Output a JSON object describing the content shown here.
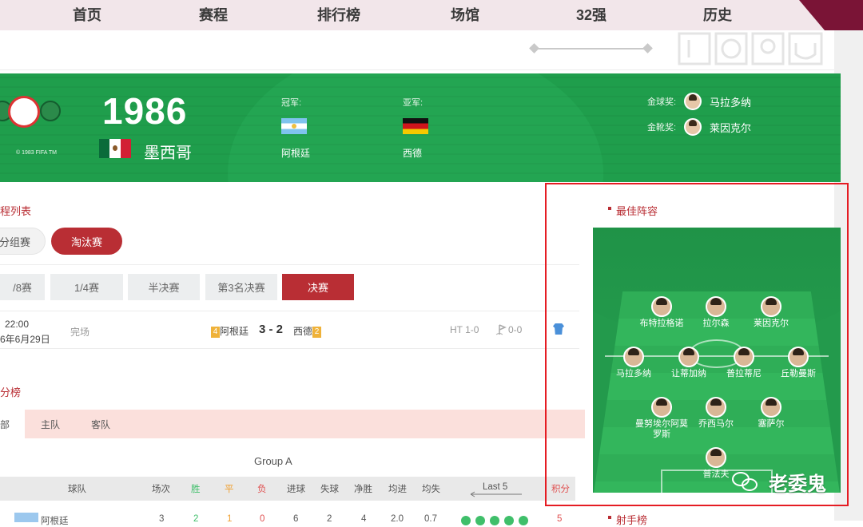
{
  "nav": {
    "items": [
      "首页",
      "赛程",
      "排行榜",
      "场馆",
      "32强",
      "历史"
    ]
  },
  "banner": {
    "fifa_tm": "© 1983 FIFA TM",
    "year": "1986",
    "host": "墨西哥",
    "champion_label": "冠军:",
    "champion": "阿根廷",
    "runner_up_label": "亚军:",
    "runner_up": "西德",
    "golden_ball_label": "金球奖:",
    "golden_ball": "马拉多纳",
    "golden_boot_label": "金靴奖:",
    "golden_boot": "莱因克尔"
  },
  "schedule": {
    "title": "程列表",
    "stage_tabs": [
      "分组赛",
      "淘汰赛"
    ],
    "round_tabs": [
      "/8赛",
      "1/4赛",
      "半决赛",
      "第3名决赛",
      "决赛"
    ],
    "match": {
      "time": "22:00",
      "date": "6年6月29日",
      "status": "完场",
      "home_badge": "4",
      "home": "阿根廷",
      "score": "3 - 2",
      "away": "西德",
      "away_badge": "2",
      "ht": "HT 1-0",
      "corners": "0-0"
    }
  },
  "standings": {
    "title": "分榜",
    "tabs": [
      "部",
      "主队",
      "客队"
    ],
    "group": "Group A",
    "headers": [
      "球队",
      "场次",
      "胜",
      "平",
      "负",
      "进球",
      "失球",
      "净胜",
      "均进",
      "均失",
      "Last 5",
      "积分"
    ],
    "row": [
      "阿根廷",
      "3",
      "2",
      "1",
      "0",
      "6",
      "2",
      "4",
      "2.0",
      "0.7",
      "5"
    ]
  },
  "best_xi": {
    "title": "最佳阵容",
    "players": [
      "布特拉格诺",
      "拉尔森",
      "莱因克尔",
      "马拉多纳",
      "让蒂加纳",
      "普拉蒂尼",
      "丘勒曼斯",
      "曼努埃尔阿莫罗斯",
      "乔西马尔",
      "塞萨尔",
      "普法夫"
    ]
  },
  "next_section": "射手榜",
  "watermark": "老委鬼",
  "colors": {
    "accent": "#b92e34",
    "highlight_border": "#e51c23",
    "banner_green": "#1f9e4c"
  }
}
